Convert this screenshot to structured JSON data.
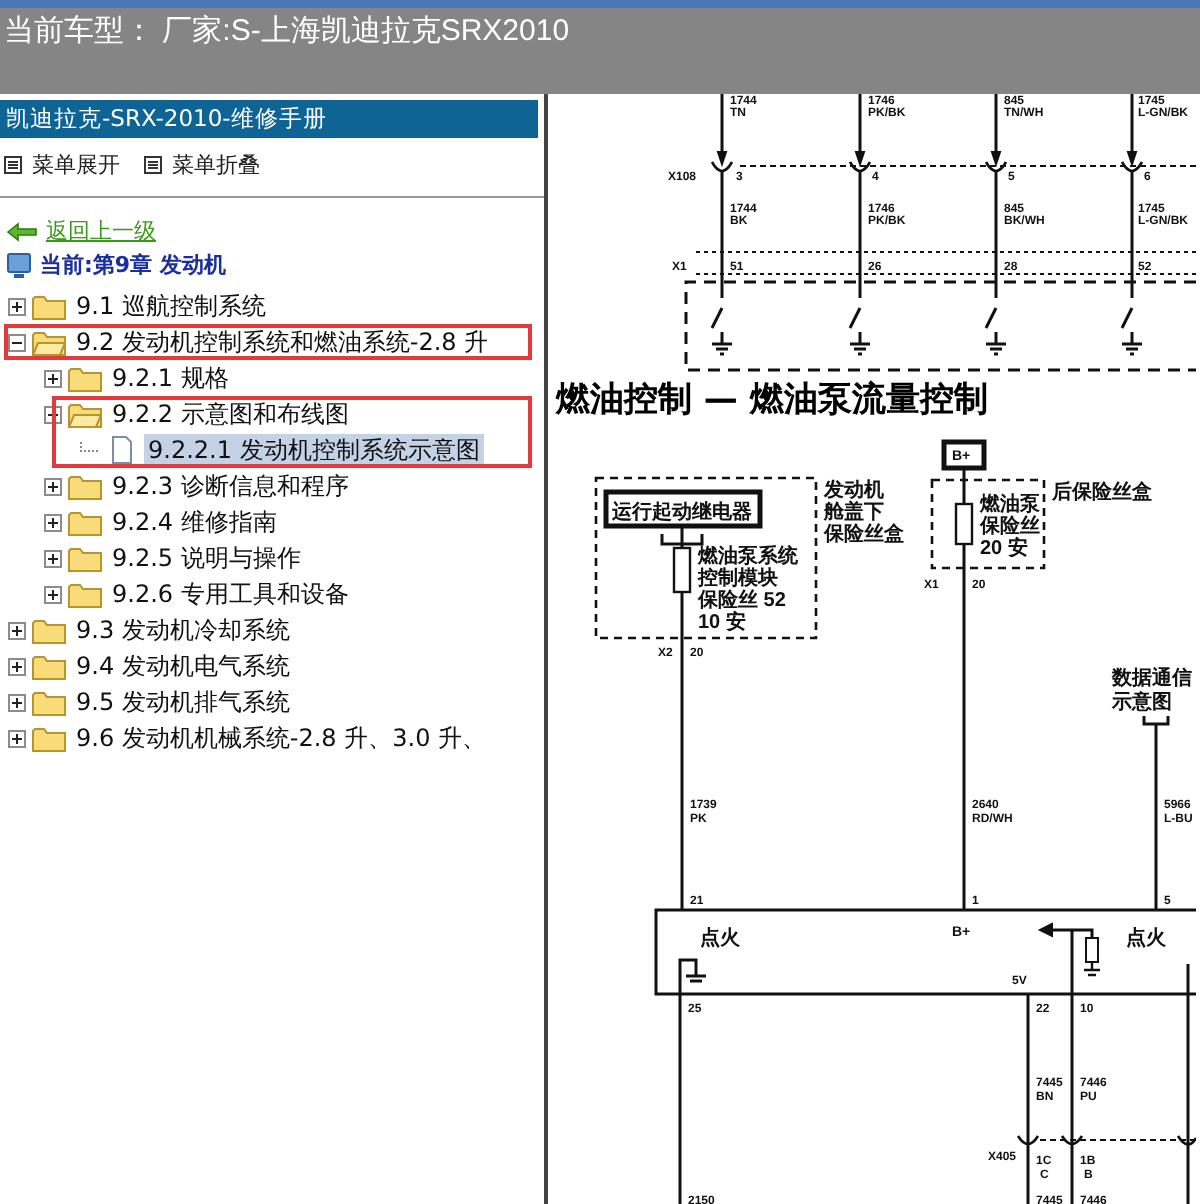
{
  "window": {
    "title": "当前车型： 厂家:S-上海凯迪拉克SRX2010"
  },
  "sidebar": {
    "title": "凯迪拉克-SRX-2010-维修手册",
    "menu_actions": [
      "菜单展开",
      "菜单折叠"
    ],
    "back_link": "返回上一级",
    "current": "当前:第9章 发动机",
    "tree": [
      {
        "label": "9.1 巡航控制系统",
        "kind": "folder",
        "expanded": false,
        "selected": false
      },
      {
        "label": "9.2 发动机控制系统和燃油系统-2.8 升",
        "kind": "folder",
        "expanded": true,
        "selected": false,
        "framed": true,
        "children": [
          {
            "label": "9.2.1 规格",
            "kind": "folder",
            "expanded": false,
            "selected": false
          },
          {
            "label": "9.2.2 示意图和布线图",
            "kind": "folder",
            "expanded": true,
            "selected": false,
            "framed_group": true,
            "children": [
              {
                "label": "9.2.2.1 发动机控制系统示意图",
                "kind": "page",
                "selected": true
              }
            ]
          },
          {
            "label": "9.2.3 诊断信息和程序",
            "kind": "folder",
            "expanded": false,
            "selected": false
          },
          {
            "label": "9.2.4 维修指南",
            "kind": "folder",
            "expanded": false,
            "selected": false
          },
          {
            "label": "9.2.5 说明与操作",
            "kind": "folder",
            "expanded": false,
            "selected": false
          },
          {
            "label": "9.2.6 专用工具和设备",
            "kind": "folder",
            "expanded": false,
            "selected": false
          }
        ]
      },
      {
        "label": "9.3 发动机冷却系统",
        "kind": "folder",
        "expanded": false,
        "selected": false
      },
      {
        "label": "9.4 发动机电气系统",
        "kind": "folder",
        "expanded": false,
        "selected": false
      },
      {
        "label": "9.5 发动机排气系统",
        "kind": "folder",
        "expanded": false,
        "selected": false
      },
      {
        "label": "9.6 发动机机械系统-2.8 升、3.0 升、",
        "kind": "folder",
        "expanded": false,
        "selected": false
      }
    ]
  },
  "document": {
    "heading": "燃油控制 — 燃油泵流量控制",
    "diagram_labels": [
      "1744",
      "TN",
      "1746",
      "PK/BK",
      "845",
      "TN/WH",
      "1745",
      "L-GN/BK",
      "X108",
      "3",
      "4",
      "5",
      "6",
      "1744",
      "BK",
      "1746",
      "PK/BK",
      "845",
      "BK/WH",
      "1745",
      "L-GN/BK",
      "X1",
      "51",
      "26",
      "28",
      "52",
      "B+",
      "运行起动继电器",
      "发动机",
      "舱盖下",
      "保险丝盒",
      "燃油泵系统",
      "控制模块",
      "保险丝 52",
      "10 安",
      "后保险丝盒",
      "燃油泵",
      "保险丝",
      "20 安",
      "X1",
      "20",
      "X2",
      "20",
      "数据通信",
      "示意图",
      "1739",
      "PK",
      "2640",
      "RD/WH",
      "5966",
      "L-BU",
      "21",
      "1",
      "5",
      "点火",
      "B+",
      "点火",
      "5V",
      "25",
      "22",
      "10",
      "7445",
      "BN",
      "7446",
      "PU",
      "X405",
      "1C",
      "C",
      "1B",
      "B",
      "2150",
      "7445",
      "7446"
    ]
  }
}
